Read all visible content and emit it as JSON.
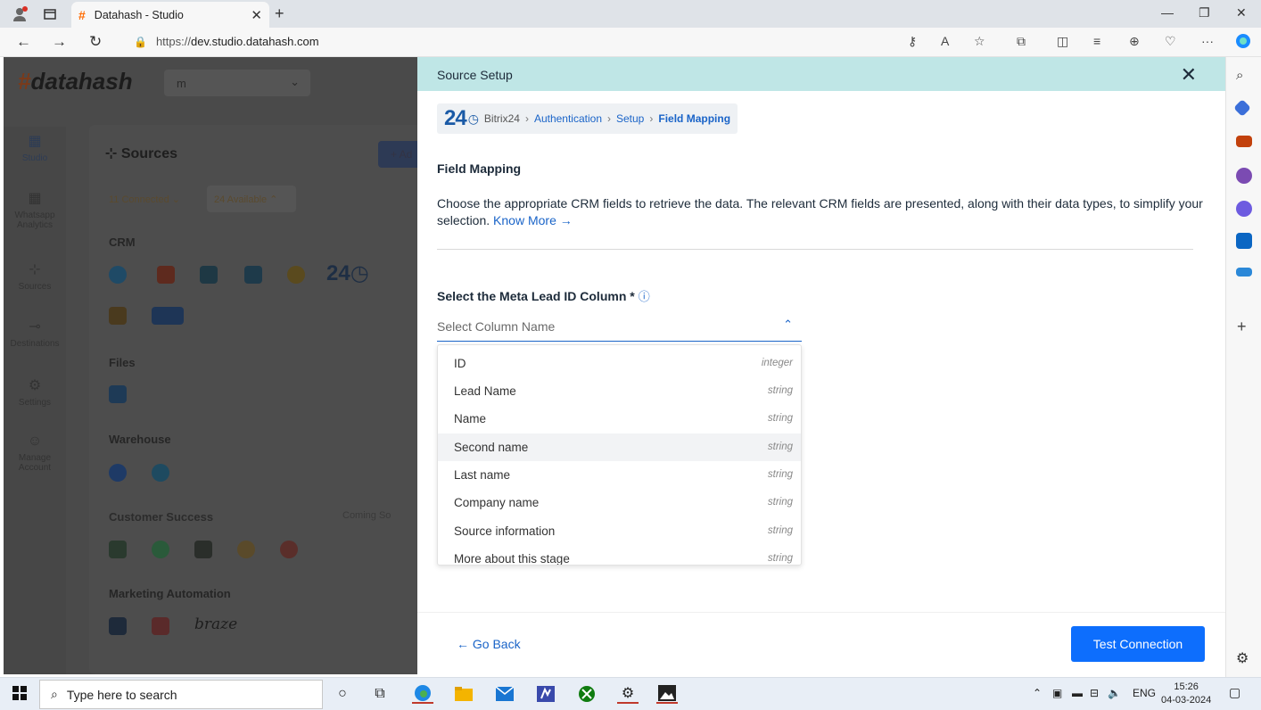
{
  "browser": {
    "tab_title": "Datahash - Studio",
    "url_prefix": "https://",
    "url_host": "dev.studio.datahash.com"
  },
  "app": {
    "logo_text": "datahash",
    "workspace_value": "m",
    "rail": [
      {
        "label": "Studio"
      },
      {
        "label": "Whatsapp Analytics"
      },
      {
        "label": "Sources"
      },
      {
        "label": "Destinations"
      },
      {
        "label": "Settings"
      },
      {
        "label": "Manage Account"
      }
    ],
    "sources_heading": "Sources",
    "add_button": "+ Ad",
    "connected_chip": "11 Connected",
    "available_chip": "24 Available",
    "sections": {
      "crm": "CRM",
      "files": "Files",
      "warehouse": "Warehouse",
      "customer_success": "Customer Success",
      "coming_soon": "Coming So",
      "marketing": "Marketing Automation"
    },
    "bitrix_logo": "24",
    "braze_logo": "braze"
  },
  "modal": {
    "title": "Source Setup",
    "breadcrumb": {
      "logo": "24",
      "items": [
        "Bitrix24",
        "Authentication",
        "Setup",
        "Field Mapping"
      ]
    },
    "section_title": "Field Mapping",
    "description": "Choose the appropriate CRM fields to retrieve the data. The relevant CRM fields are presented, along with their data types, to simplify your selection.",
    "know_more": "Know More →",
    "select_label": "Select the Meta Lead ID Column *",
    "select_placeholder": "Select Column Name",
    "options": [
      {
        "name": "ID",
        "type": "integer"
      },
      {
        "name": "Lead Name",
        "type": "string"
      },
      {
        "name": "Name",
        "type": "string"
      },
      {
        "name": "Second name",
        "type": "string"
      },
      {
        "name": "Last name",
        "type": "string"
      },
      {
        "name": "Company name",
        "type": "string"
      },
      {
        "name": "Source information",
        "type": "string"
      },
      {
        "name": "More about this stage",
        "type": "string"
      }
    ],
    "highlighted_option": "Second name",
    "go_back": "← Go Back",
    "test_connection": "Test Connection"
  },
  "taskbar": {
    "search_placeholder": "Type here to search",
    "language": "ENG",
    "time": "15:26",
    "date": "04-03-2024"
  },
  "colors": {
    "primary": "#0d6efd",
    "link": "#1a64c8",
    "modal_header": "#bfe6e6"
  }
}
